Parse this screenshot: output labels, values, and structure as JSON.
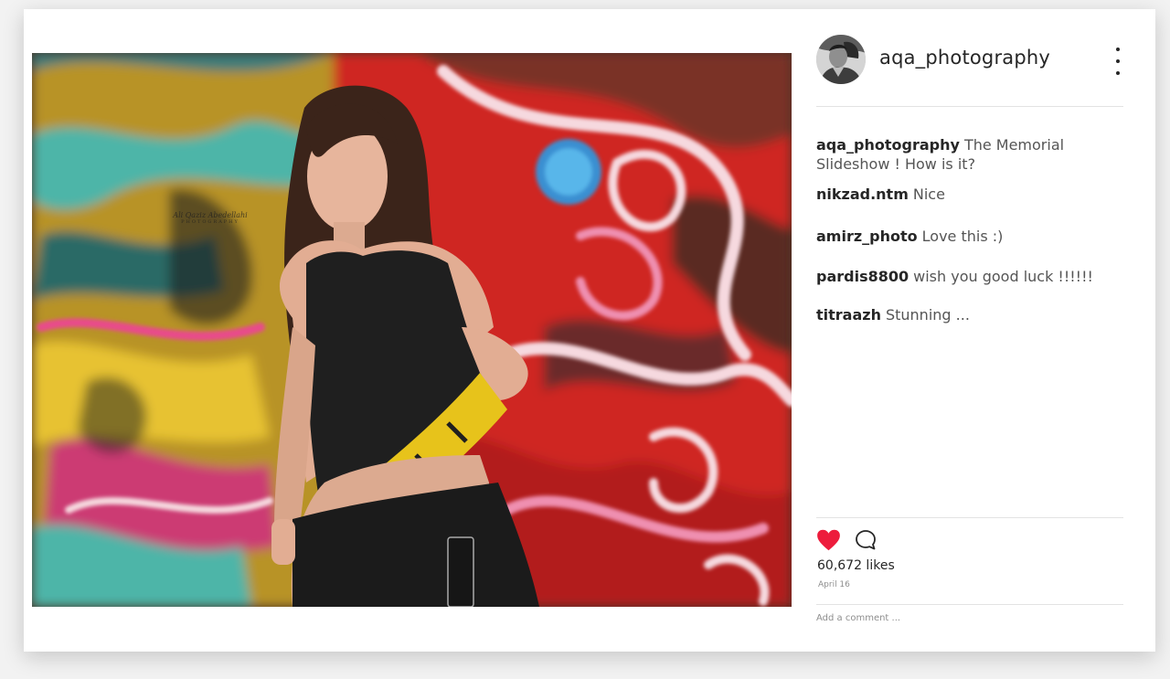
{
  "post": {
    "author": "aqa_photography",
    "more_icon": "more-vertical-icon",
    "photo_watermark": {
      "line1": "Ali Qaziz Abedellahi",
      "line2": "PHOTOGRAPHY"
    }
  },
  "comments": [
    {
      "user": "aqa_photography",
      "text": "The Memorial Slideshow ! How is it?"
    },
    {
      "user": "nikzad.ntm",
      "text": "Nice"
    },
    {
      "user": "amirz_photo",
      "text": "Love this :)"
    },
    {
      "user": "pardis8800",
      "text": "wish you good luck !!!!!!"
    },
    {
      "user": "titraazh",
      "text": "Stunning ..."
    }
  ],
  "actions": {
    "like_icon": "heart-icon",
    "comment_icon": "comment-bubble-icon",
    "liked": true,
    "like_color": "#ed1c3c"
  },
  "likes_text": "60,672 likes",
  "date": "April 16",
  "add_comment": {
    "placeholder": "Add a comment ..."
  }
}
